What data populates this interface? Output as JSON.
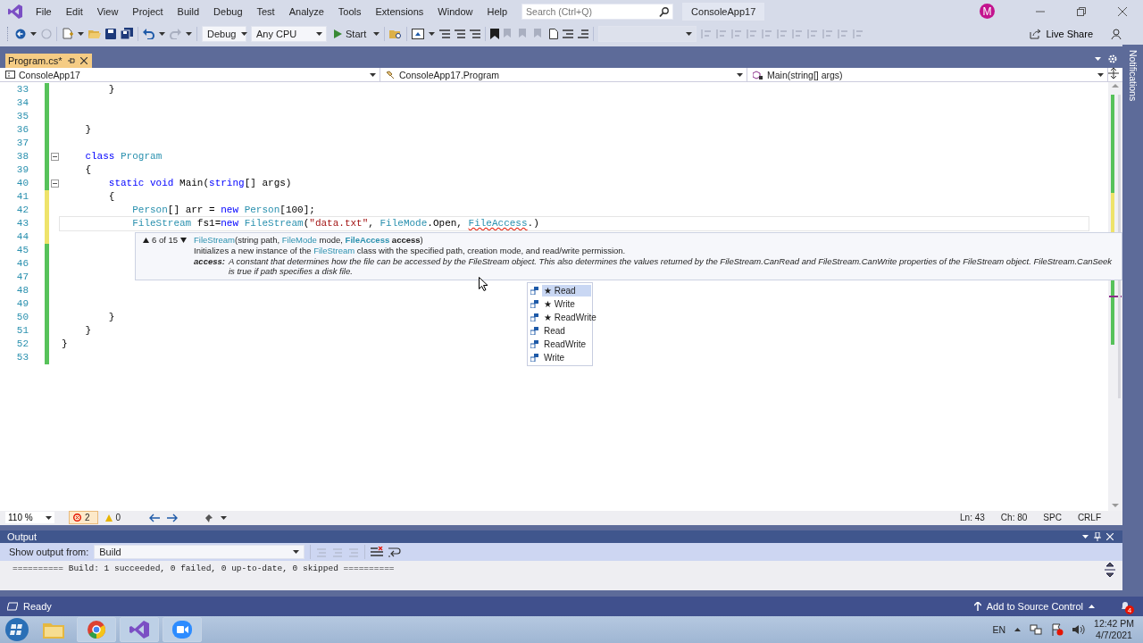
{
  "menu_bar": {
    "items": [
      "File",
      "Edit",
      "View",
      "Project",
      "Build",
      "Debug",
      "Test",
      "Analyze",
      "Tools",
      "Extensions",
      "Window",
      "Help"
    ],
    "search": {
      "placeholder": "Search (Ctrl+Q)"
    },
    "solution_name": "ConsoleApp17",
    "avatar": "M"
  },
  "toolbar": {
    "configuration": "Debug",
    "platform": "Any CPU",
    "start": "Start",
    "live_share": "Live Share"
  },
  "tabs": [
    {
      "label": "Program.cs*",
      "selected": true
    }
  ],
  "notifications_label": "Notifications",
  "nav_bar": {
    "project": "ConsoleApp17",
    "type": "ConsoleApp17.Program",
    "member": "Main(string[] args)"
  },
  "editor": {
    "lines": [
      {
        "number": "33",
        "modified": false,
        "fold": false,
        "current": false,
        "tokens": [
          {
            "text": "        }",
            "kind": "plain"
          }
        ]
      },
      {
        "number": "34",
        "modified": false,
        "fold": false,
        "current": false
      },
      {
        "number": "35",
        "modified": false,
        "fold": false,
        "current": false
      },
      {
        "number": "36",
        "modified": false,
        "fold": false,
        "current": false,
        "tokens": [
          {
            "text": "    }",
            "kind": "plain"
          }
        ]
      },
      {
        "number": "37",
        "modified": false,
        "fold": false,
        "current": false
      },
      {
        "number": "38",
        "modified": false,
        "fold": true,
        "current": false,
        "tokens": [
          {
            "text": "    class",
            "kind": "keyword"
          },
          {
            "text": " Program",
            "kind": "type"
          }
        ]
      },
      {
        "number": "39",
        "modified": false,
        "fold": false,
        "current": false,
        "tokens": [
          {
            "text": "    {",
            "kind": "plain"
          }
        ]
      },
      {
        "number": "40",
        "modified": false,
        "fold": true,
        "current": false,
        "tokens": [
          {
            "text": "        static",
            "kind": "keyword"
          },
          {
            "text": " void",
            "kind": "keyword"
          },
          {
            "text": " Main(",
            "kind": "plain"
          },
          {
            "text": "string",
            "kind": "keyword"
          },
          {
            "text": "[] args)",
            "kind": "plain"
          }
        ]
      },
      {
        "number": "41",
        "modified": true,
        "fold": false,
        "current": false,
        "tokens": [
          {
            "text": "        {",
            "kind": "plain"
          }
        ]
      },
      {
        "number": "42",
        "modified": true,
        "fold": false,
        "current": false,
        "tokens": [
          {
            "text": "            Person",
            "kind": "type"
          },
          {
            "text": "[] arr = ",
            "kind": "plain"
          },
          {
            "text": "new",
            "kind": "keyword"
          },
          {
            "text": " Person",
            "kind": "type"
          },
          {
            "text": "[100];",
            "kind": "plain"
          }
        ]
      },
      {
        "number": "43",
        "modified": true,
        "fold": false,
        "current": true,
        "tokens": [
          {
            "text": "            FileStream",
            "kind": "type"
          },
          {
            "text": " fs1=",
            "kind": "plain"
          },
          {
            "text": "new",
            "kind": "keyword"
          },
          {
            "text": " FileStream",
            "kind": "type"
          },
          {
            "text": "(",
            "kind": "plain"
          },
          {
            "text": "\"data.txt\"",
            "kind": "string"
          },
          {
            "text": ", ",
            "kind": "plain"
          },
          {
            "text": "FileMode",
            "kind": "type"
          },
          {
            "text": ".Open, ",
            "kind": "plain"
          },
          {
            "text": "FileAccess",
            "kind": "error"
          },
          {
            "text": ".)",
            "kind": "plain"
          }
        ]
      },
      {
        "number": "44",
        "modified": true,
        "fold": false,
        "current": false
      },
      {
        "number": "45",
        "modified": false,
        "fold": false,
        "current": false
      },
      {
        "number": "46",
        "modified": false,
        "fold": false,
        "current": false
      },
      {
        "number": "47",
        "modified": false,
        "fold": false,
        "current": false
      },
      {
        "number": "48",
        "modified": false,
        "fold": false,
        "current": false
      },
      {
        "number": "49",
        "modified": false,
        "fold": false,
        "current": false
      },
      {
        "number": "50",
        "modified": false,
        "fold": false,
        "current": false,
        "tokens": [
          {
            "text": "        }",
            "kind": "plain"
          }
        ]
      },
      {
        "number": "51",
        "modified": false,
        "fold": false,
        "current": false,
        "tokens": [
          {
            "text": "    }",
            "kind": "plain"
          }
        ]
      },
      {
        "number": "52",
        "modified": false,
        "fold": false,
        "current": false,
        "tokens": [
          {
            "text": "}",
            "kind": "plain"
          }
        ]
      },
      {
        "number": "53",
        "modified": false,
        "fold": false,
        "current": false
      }
    ]
  },
  "signature_help": {
    "counter": "6 of 15",
    "signature": [
      {
        "text": "FileStream",
        "kind": "type"
      },
      {
        "text": "(string path, ",
        "kind": "plain"
      },
      {
        "text": "FileMode",
        "kind": "type"
      },
      {
        "text": " mode, ",
        "kind": "plain"
      },
      {
        "text": "FileAccess",
        "kind": "type-bold"
      },
      {
        "text": " access",
        "kind": "bold"
      },
      {
        "text": ")",
        "kind": "plain"
      }
    ],
    "summary": [
      {
        "text": "Initializes a new instance of the ",
        "kind": "plain"
      },
      {
        "text": "FileStream",
        "kind": "type"
      },
      {
        "text": " class with the specified path, creation mode, and read/write permission.",
        "kind": "plain"
      }
    ],
    "param_name": "access:",
    "param_text": "A constant that determines how the file can be accessed by the FileStream object. This also determines the values returned by the FileStream.CanRead and FileStream.CanWrite properties of the FileStream object. FileStream.CanSeek is true if path specifies a disk file."
  },
  "completion": {
    "items": [
      {
        "label": "★ Read",
        "selected": true
      },
      {
        "label": "★ Write",
        "selected": false
      },
      {
        "label": "★ ReadWrite",
        "selected": false
      },
      {
        "label": "Read",
        "selected": false
      },
      {
        "label": "ReadWrite",
        "selected": false
      },
      {
        "label": "Write",
        "selected": false
      }
    ]
  },
  "editor_status": {
    "zoom": "110 %",
    "errors": "2",
    "warnings": "0",
    "line": "Ln: 43",
    "column": "Ch: 80",
    "whitespace": "SPC",
    "line_ending": "CRLF"
  },
  "output": {
    "title": "Output",
    "source_label": "Show output from:",
    "source": "Build",
    "text": "========== Build: 1 succeeded, 0 failed, 0 up-to-date, 0 skipped =========="
  },
  "status_bar": {
    "text": "Ready",
    "source_control": "Add to Source Control",
    "notification_count": "4"
  },
  "taskbar": {
    "language": "EN",
    "time": "12:42 PM",
    "date": "4/7/2021"
  }
}
